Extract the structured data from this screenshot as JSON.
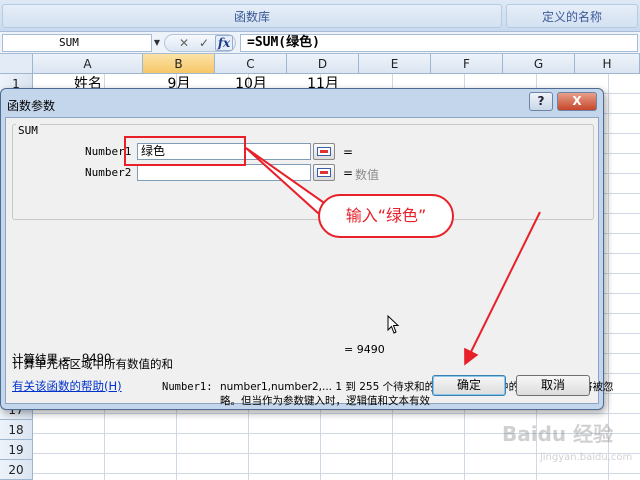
{
  "ribbon": {
    "group1": "函数库",
    "group2": "定义的名称"
  },
  "formula_bar": {
    "name_box": "SUM",
    "cancel_glyph": "✕",
    "enter_glyph": "✓",
    "fx_glyph": "fx",
    "formula": "=SUM(绿色)"
  },
  "sheet": {
    "columns": [
      "A",
      "B",
      "C",
      "D",
      "E",
      "F",
      "G",
      "H"
    ],
    "visible_rows_top": [
      "1"
    ],
    "visible_rows_bottom": [
      "17",
      "18",
      "19",
      "20"
    ],
    "row1": {
      "A": "姓名",
      "B": "9月",
      "C": "10月",
      "D": "11月"
    }
  },
  "dialog": {
    "title": "函数参数",
    "help_btn": "?",
    "close_btn": "X",
    "function_name": "SUM",
    "args": [
      {
        "label": "Number1",
        "value": "绿色",
        "eq": "=",
        "hint": ""
      },
      {
        "label": "Number2",
        "value": "",
        "eq": "=",
        "hint": "数值"
      }
    ],
    "result_eq": "= 9490",
    "description": "计算单元格区域中所有数值的和",
    "arg_desc_label": "Number1:",
    "arg_desc_text": "number1,number2,... 1 到 255 个待求和的数值。单元格中的逻辑值和文本将被忽略。但当作为参数键入时，逻辑值和文本有效",
    "calc_result_label": "计算结果 =",
    "calc_result_value": "9490",
    "help_link": "有关该函数的帮助(H)",
    "ok": "确定",
    "cancel": "取消"
  },
  "annotation": {
    "callout": "输入“绿色”",
    "color": "#e8202a"
  },
  "watermark": {
    "main": "Baidu 经验",
    "sub": "jingyan.baidu.com"
  }
}
